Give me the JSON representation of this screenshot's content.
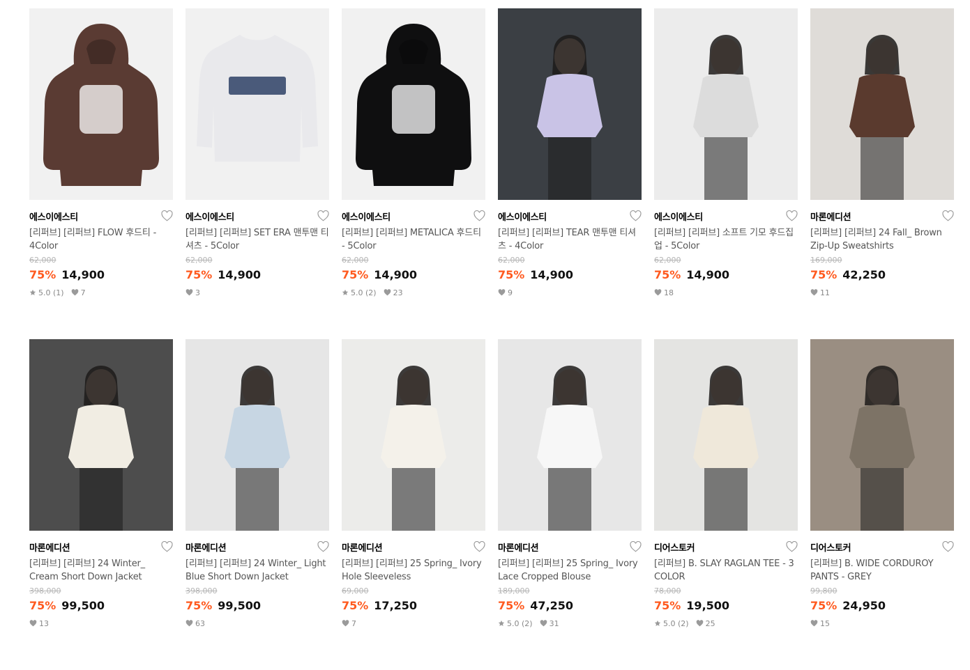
{
  "products": [
    {
      "brand": "에스이에스티",
      "title": "[리퍼브] [리퍼브] FLOW 후드티 - 4Color",
      "original_price": "62,000",
      "discount": "75%",
      "price": "14,900",
      "rating": "5.0 (1)",
      "likes": "7",
      "bg": "#f1f1f1",
      "garment": "#5a3b33",
      "kind": "hoodie"
    },
    {
      "brand": "에스이에스티",
      "title": "[리퍼브] [리퍼브] SET ERA 맨투맨 티셔츠 - 5Color",
      "original_price": "62,000",
      "discount": "75%",
      "price": "14,900",
      "rating": "",
      "likes": "3",
      "bg": "#f1f1f1",
      "garment": "#e9e9ec",
      "kind": "sweat"
    },
    {
      "brand": "에스이에스티",
      "title": "[리퍼브] [리퍼브] METALICA 후드티 - 5Color",
      "original_price": "62,000",
      "discount": "75%",
      "price": "14,900",
      "rating": "5.0 (2)",
      "likes": "23",
      "bg": "#f1f1f1",
      "garment": "#0f0f10",
      "kind": "hoodie"
    },
    {
      "brand": "에스이에스티",
      "title": "[리퍼브] [리퍼브] TEAR 맨투맨 티셔츠 - 4Color",
      "original_price": "62,000",
      "discount": "75%",
      "price": "14,900",
      "rating": "",
      "likes": "9",
      "bg": "#3b3f44",
      "garment": "#c9c3e6",
      "kind": "model"
    },
    {
      "brand": "에스이에스티",
      "title": "[리퍼브] [리퍼브] 소프트 기모 후드집업 - 5Color",
      "original_price": "62,000",
      "discount": "75%",
      "price": "14,900",
      "rating": "",
      "likes": "18",
      "bg": "#ececec",
      "garment": "#dcdcdc",
      "kind": "model"
    },
    {
      "brand": "마론에디션",
      "title": "[리퍼브] [리퍼브] 24 Fall_ Brown Zip-Up Sweatshirts",
      "original_price": "169,000",
      "discount": "75%",
      "price": "42,250",
      "rating": "",
      "likes": "11",
      "bg": "#dfdcd8",
      "garment": "#5a3a2e",
      "kind": "model"
    },
    {
      "brand": "마론에디션",
      "title": "[리퍼브] [리퍼브] 24 Winter_ Cream Short Down Jacket",
      "original_price": "398,000",
      "discount": "75%",
      "price": "99,500",
      "rating": "",
      "likes": "13",
      "bg": "#4d4d4d",
      "garment": "#f1ede3",
      "kind": "model"
    },
    {
      "brand": "마론에디션",
      "title": "[리퍼브] [리퍼브] 24 Winter_ Light Blue Short Down Jacket",
      "original_price": "398,000",
      "discount": "75%",
      "price": "99,500",
      "rating": "",
      "likes": "63",
      "bg": "#e6e6e6",
      "garment": "#c7d6e3",
      "kind": "model"
    },
    {
      "brand": "마론에디션",
      "title": "[리퍼브] [리퍼브] 25 Spring_ Ivory Hole Sleeveless",
      "original_price": "69,000",
      "discount": "75%",
      "price": "17,250",
      "rating": "",
      "likes": "7",
      "bg": "#ececea",
      "garment": "#f4f1ea",
      "kind": "model"
    },
    {
      "brand": "마론에디션",
      "title": "[리퍼브] [리퍼브] 25 Spring_ Ivory Lace Cropped Blouse",
      "original_price": "189,000",
      "discount": "75%",
      "price": "47,250",
      "rating": "5.0 (2)",
      "likes": "31",
      "bg": "#e7e7e7",
      "garment": "#f7f7f7",
      "kind": "model"
    },
    {
      "brand": "디어스토커",
      "title": "[리퍼브] B. SLAY RAGLAN TEE - 3 COLOR",
      "original_price": "78,000",
      "discount": "75%",
      "price": "19,500",
      "rating": "5.0 (2)",
      "likes": "25",
      "bg": "#e4e4e2",
      "garment": "#efe8da",
      "kind": "model"
    },
    {
      "brand": "디어스토커",
      "title": "[리퍼브] B. WIDE CORDUROY PANTS - GREY",
      "original_price": "99,800",
      "discount": "75%",
      "price": "24,950",
      "rating": "",
      "likes": "15",
      "bg": "#9a8e82",
      "garment": "#7d7366",
      "kind": "model"
    }
  ],
  "colors": {
    "discount": "#ff5a1f",
    "meta": "#888888",
    "heart_outline": "#9a9a9a"
  },
  "icons": {
    "wishlist": "heart-outline-icon",
    "rating": "star-icon",
    "likes": "heart-filled-icon"
  }
}
